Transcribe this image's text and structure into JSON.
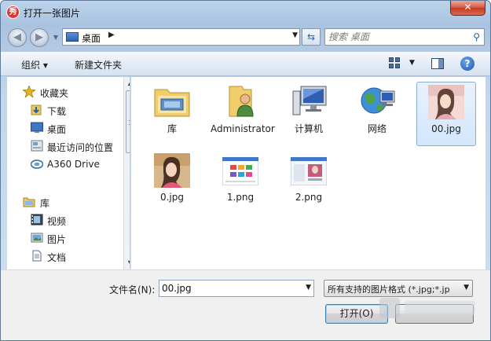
{
  "window": {
    "title": "打开一张图片",
    "close_label": "✕"
  },
  "navbar": {
    "location": "桌面",
    "search_placeholder": "搜索 桌面"
  },
  "toolbar": {
    "organize_label": "组织 ▾",
    "new_folder_label": "新建文件夹"
  },
  "sidebar": {
    "items": [
      {
        "label": "收藏夹",
        "icon": "star-icon"
      },
      {
        "label": "下载",
        "icon": "download-folder-icon"
      },
      {
        "label": "桌面",
        "icon": "desktop-icon"
      },
      {
        "label": "最近访问的位置",
        "icon": "recent-places-icon"
      },
      {
        "label": "A360 Drive",
        "icon": "cloud-drive-icon"
      },
      {
        "label": "库",
        "icon": "library-icon"
      },
      {
        "label": "视频",
        "icon": "video-icon"
      },
      {
        "label": "图片",
        "icon": "pictures-icon"
      },
      {
        "label": "文档",
        "icon": "documents-icon"
      }
    ]
  },
  "files": [
    {
      "name": "库",
      "icon": "library-folder-icon"
    },
    {
      "name": "Administrator",
      "icon": "user-folder-icon"
    },
    {
      "name": "计算机",
      "icon": "computer-icon"
    },
    {
      "name": "网络",
      "icon": "network-icon"
    },
    {
      "name": "00.jpg",
      "icon": "image-thumbnail",
      "selected": true
    },
    {
      "name": "0.jpg",
      "icon": "image-thumbnail"
    },
    {
      "name": "1.png",
      "icon": "screenshot-thumbnail"
    },
    {
      "name": "2.png",
      "icon": "screenshot-thumbnail"
    }
  ],
  "footer": {
    "filename_label": "文件名(N):",
    "filename_value": "00.jpg",
    "filetype_value": "所有支持的图片格式 (*.jpg;*.jp",
    "open_label": "打开(O)"
  },
  "colors": {
    "selection": "#cfe3fb",
    "accent": "#3c7fb1",
    "close_red": "#c23b22"
  }
}
